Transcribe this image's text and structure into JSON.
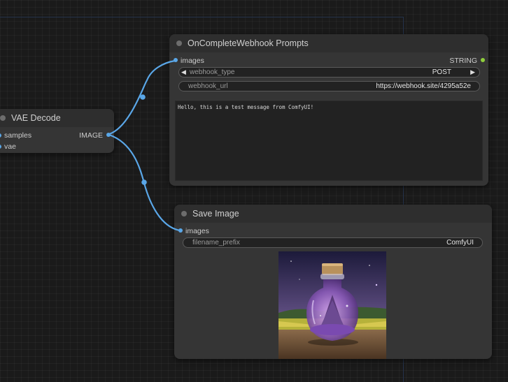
{
  "vae_decode": {
    "title": "VAE Decode",
    "inputs": [
      "samples",
      "vae"
    ],
    "output": "IMAGE"
  },
  "webhook_node": {
    "title": "OnCompleteWebhook Prompts",
    "input": "images",
    "output": "STRING",
    "webhook_type_label": "webhook_type",
    "webhook_type_value": "POST",
    "webhook_url_label": "webhook_url",
    "webhook_url_value": "https://webhook.site/4295a52e",
    "message": "Hello, this is a test message from ComfyUI!"
  },
  "save_node": {
    "title": "Save Image",
    "input": "images",
    "filename_prefix_label": "filename_prefix",
    "filename_prefix_value": "ComfyUI"
  },
  "colors": {
    "canvas": "#1a1a1a",
    "node_body": "#353535",
    "node_header": "#2e2e2e",
    "link": "#5aa7e8",
    "string_slot": "#8fce3c"
  },
  "icons": {
    "left_arrow": "◀",
    "right_arrow": "▶"
  }
}
